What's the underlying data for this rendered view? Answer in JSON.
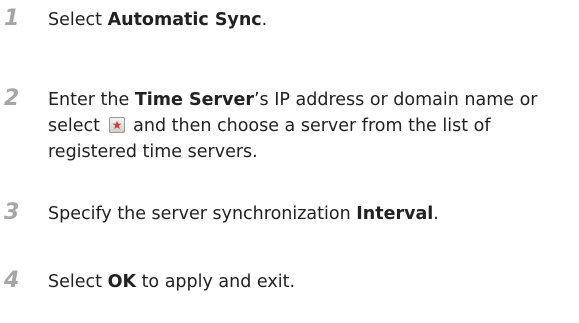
{
  "steps": [
    {
      "number": "1",
      "text_before": "Select ",
      "bold": "Automatic Sync",
      "text_after": "."
    },
    {
      "number": "2",
      "text_before": "Enter the ",
      "bold": "Time Server",
      "text_middle": "’s IP address or domain name or select ",
      "icon": "star-icon",
      "text_after": " and then choose a server from the list of registered time servers."
    },
    {
      "number": "3",
      "text_before": "Specify the server synchronization ",
      "bold": "Interval",
      "text_after": "."
    },
    {
      "number": "4",
      "text_before": "Select ",
      "bold": "OK",
      "text_after": " to apply and exit."
    }
  ],
  "colors": {
    "step_number": "#a6a6a6",
    "text": "#222222",
    "icon_star": "#c8423b"
  }
}
